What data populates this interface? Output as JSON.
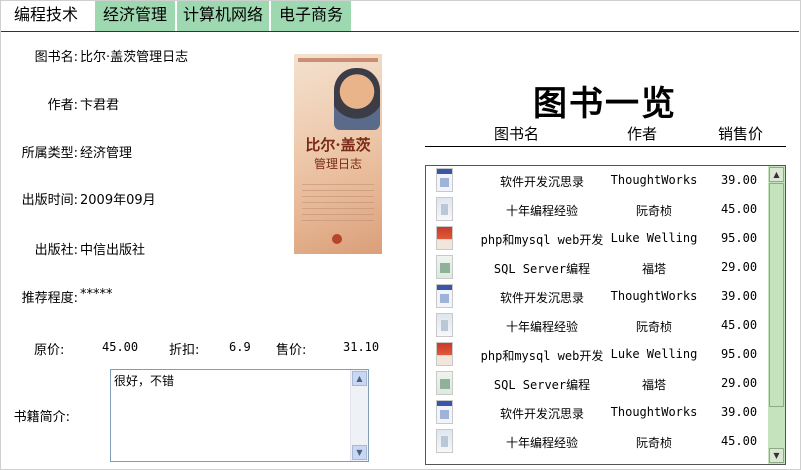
{
  "tabs": [
    {
      "label": "编程技术",
      "active": true
    },
    {
      "label": "经济管理",
      "active": false
    },
    {
      "label": "计算机网络",
      "active": false
    },
    {
      "label": "电子商务",
      "active": false
    }
  ],
  "detail": {
    "title_label": "图书名:",
    "title_value": "比尔·盖茨管理日志",
    "author_label": "作者:",
    "author_value": "卞君君",
    "category_label": "所属类型:",
    "category_value": "经济管理",
    "date_label": "出版时间:",
    "date_value": "2009年09月",
    "publisher_label": "出版社:",
    "publisher_value": "中信出版社",
    "rating_label": "推荐程度:",
    "rating_value": "*****",
    "original_price_label": "原价:",
    "original_price_value": "45.00",
    "discount_label": "折扣:",
    "discount_value": "6.9",
    "sale_price_label": "售价:",
    "sale_price_value": "31.10",
    "intro_label": "书籍简介:",
    "intro_value": "很好，不错"
  },
  "cover": {
    "title_line1": "比尔·盖茨",
    "title_line2": "管理日志"
  },
  "book_list": {
    "title": "图书一览",
    "columns": [
      "图书名",
      "作者",
      "销售价"
    ],
    "rows": [
      {
        "name": "软件开发沉思录",
        "author": "ThoughtWorks",
        "price": "39.00",
        "thumb": "blue"
      },
      {
        "name": "十年编程经验",
        "author": "阮奇桢",
        "price": "45.00",
        "thumb": "gray"
      },
      {
        "name": "php和mysql web开发",
        "author": "Luke Welling",
        "price": "95.00",
        "thumb": "red"
      },
      {
        "name": "SQL Server编程",
        "author": "福塔",
        "price": "29.00",
        "thumb": "green"
      },
      {
        "name": "软件开发沉思录",
        "author": "ThoughtWorks",
        "price": "39.00",
        "thumb": "blue"
      },
      {
        "name": "十年编程经验",
        "author": "阮奇桢",
        "price": "45.00",
        "thumb": "gray"
      },
      {
        "name": "php和mysql web开发",
        "author": "Luke Welling",
        "price": "95.00",
        "thumb": "red"
      },
      {
        "name": "SQL Server编程",
        "author": "福塔",
        "price": "29.00",
        "thumb": "green"
      },
      {
        "name": "软件开发沉思录",
        "author": "ThoughtWorks",
        "price": "39.00",
        "thumb": "blue"
      },
      {
        "name": "十年编程经验",
        "author": "阮奇桢",
        "price": "45.00",
        "thumb": "gray"
      }
    ]
  },
  "colors": {
    "tab_inactive": "#9ed8b0",
    "scrollbar_green": "#c5e3bd"
  }
}
